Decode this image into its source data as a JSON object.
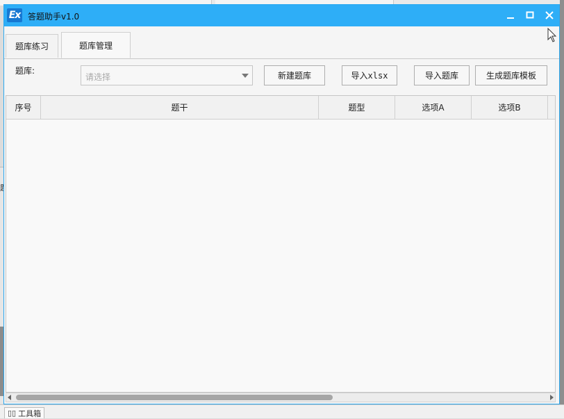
{
  "window": {
    "icon_text": "Ex",
    "title": "答题助手v1.0"
  },
  "tabs": [
    {
      "label": "题库练习",
      "active": false
    },
    {
      "label": "题库管理",
      "active": true
    }
  ],
  "toolbar": {
    "library_label": "题库:",
    "select_placeholder": "请选择",
    "buttons": {
      "new_bank": "新建题库",
      "import_xlsx": "导入xlsx",
      "import_bank": "导入题库",
      "generate_template": "生成题库模板"
    }
  },
  "table": {
    "columns": [
      "序号",
      "题干",
      "题型",
      "选项A",
      "选项B"
    ],
    "rows": []
  },
  "background": {
    "left_char": "题",
    "taskbar_tab": "工具箱"
  },
  "colors": {
    "titlebar": "#2eaef7",
    "icon_bg": "#1778d2"
  }
}
